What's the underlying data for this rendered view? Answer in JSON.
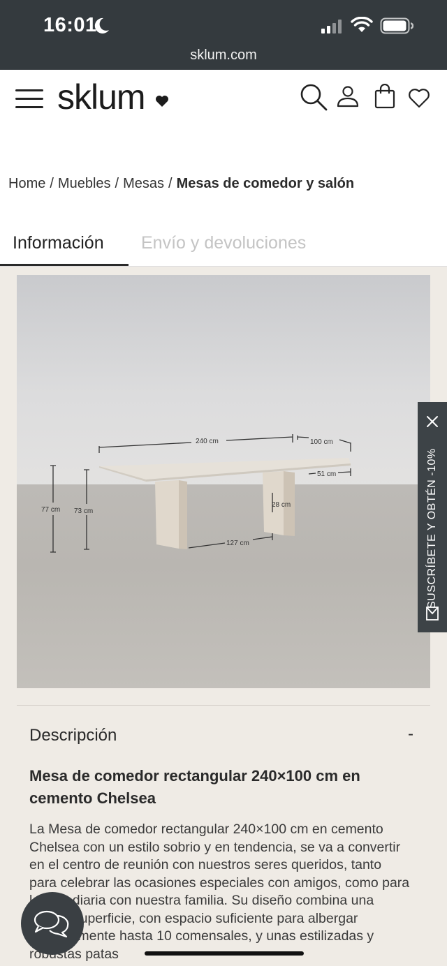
{
  "status": {
    "time": "16:01",
    "url": "sklum.com"
  },
  "header": {
    "logo": "sklum",
    "icons": [
      "menu-icon",
      "search-icon",
      "user-icon",
      "cart-icon",
      "heart-icon"
    ]
  },
  "breadcrumb": {
    "items": [
      "Home",
      "Muebles",
      "Mesas"
    ],
    "separator": "/",
    "current": "Mesas de comedor y salón"
  },
  "tabs": [
    {
      "label": "Información",
      "active": true
    },
    {
      "label": "Envío y devoluciones",
      "active": false
    }
  ],
  "image_dimensions": {
    "length": "240 cm",
    "width": "100 cm",
    "top_overhang": "51 cm",
    "height_total": "77 cm",
    "height_inner": "73 cm",
    "leg_width": "28 cm",
    "leg_spacing": "127 cm"
  },
  "side_tab": {
    "label": "SUSCRÍBETE Y OBTÉN -10%"
  },
  "description": {
    "heading": "Descripción",
    "toggle": "-",
    "title": "Mesa de comedor rectangular 240×100 cm en cemento Chelsea",
    "body": "La Mesa de comedor rectangular 240×100 cm en cemento Chelsea con un estilo sobrio y en tendencia, se va a convertir en el centro de reunión con nuestros seres queridos, tanto para celebrar las ocasiones especiales con amigos, como para la vida diaria con nuestra familia. Su diseño combina una amplia superficie, con espacio suficiente para albergar cómodamente hasta 10 comensales, y unas estilizadas y robustas patas"
  },
  "colors": {
    "statusbar": "#343a3e",
    "content_bg": "#efebe5",
    "side_tab": "#3d4347",
    "text": "#2a2a2a",
    "inactive_tab": "#c4c4c4"
  }
}
